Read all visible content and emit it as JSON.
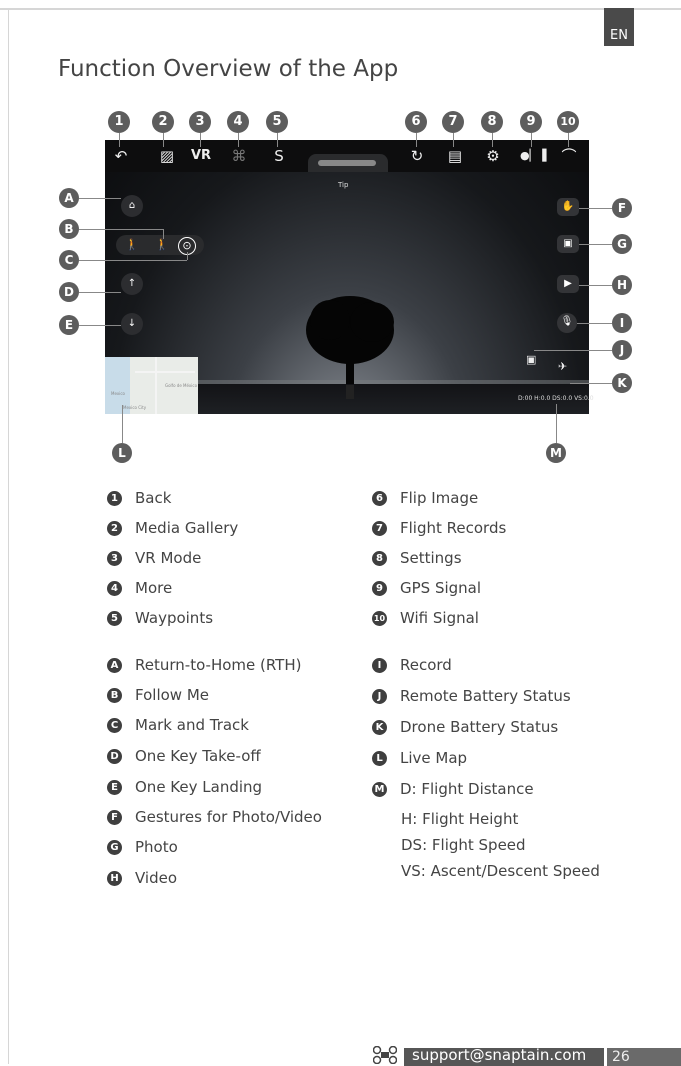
{
  "lang_tab": "EN",
  "title": "Function Overview of the App",
  "screen": {
    "tip": "Tip",
    "status_readout": "D:00 H:0.0 DS:0.0 VS:0.0",
    "map_labels": [
      "Mexico",
      "Golfo de México",
      "Mexico City"
    ]
  },
  "callouts_numbered": [
    "1",
    "2",
    "3",
    "4",
    "5",
    "6",
    "7",
    "8",
    "9",
    "10"
  ],
  "callouts_lettered": [
    "A",
    "B",
    "C",
    "D",
    "E",
    "F",
    "G",
    "H",
    "I",
    "J",
    "K",
    "L",
    "M"
  ],
  "legend_numbered_left": [
    {
      "num": "1",
      "label": "Back"
    },
    {
      "num": "2",
      "label": "Media Gallery"
    },
    {
      "num": "3",
      "label": "VR Mode"
    },
    {
      "num": "4",
      "label": "More"
    },
    {
      "num": "5",
      "label": "Waypoints"
    }
  ],
  "legend_numbered_right": [
    {
      "num": "6",
      "label": "Flip Image"
    },
    {
      "num": "7",
      "label": "Flight Records"
    },
    {
      "num": "8",
      "label": "Settings"
    },
    {
      "num": "9",
      "label": "GPS Signal"
    },
    {
      "num": "10",
      "label": "Wifi Signal"
    }
  ],
  "legend_letter_left": [
    {
      "key": "A",
      "label": "Return-to-Home (RTH)"
    },
    {
      "key": "B",
      "label": "Follow Me"
    },
    {
      "key": "C",
      "label": "Mark and Track"
    },
    {
      "key": "D",
      "label": "One Key Take-off"
    },
    {
      "key": "E",
      "label": "One Key Landing"
    },
    {
      "key": "F",
      "label": "Gestures for Photo/Video"
    },
    {
      "key": "G",
      "label": "Photo"
    },
    {
      "key": "H",
      "label": "Video"
    }
  ],
  "legend_letter_right": [
    {
      "key": "I",
      "label": "Record"
    },
    {
      "key": "J",
      "label": "Remote Battery Status"
    },
    {
      "key": "K",
      "label": "Drone Battery Status"
    },
    {
      "key": "L",
      "label": "Live Map"
    },
    {
      "key": "M",
      "label": "D: Flight Distance"
    }
  ],
  "m_details": [
    "H: Flight Height",
    "DS: Flight Speed",
    "VS: Ascent/Descent Speed"
  ],
  "footer": {
    "email": "support@snaptain.com",
    "page": "26"
  }
}
